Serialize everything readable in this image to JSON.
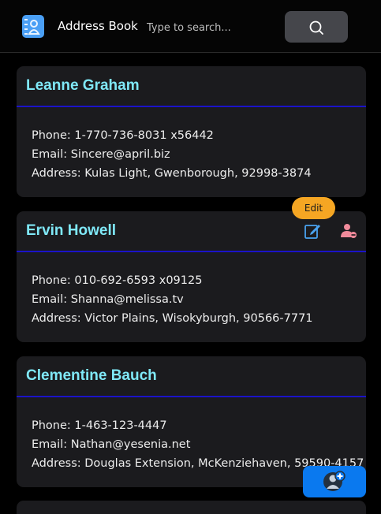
{
  "header": {
    "app_title": "Address Book",
    "search_placeholder": "Type to search...",
    "logo_icon": "contacts-book-icon",
    "search_icon": "search-icon"
  },
  "contacts": [
    {
      "name": "Leanne Graham",
      "phone": "Phone: 1-770-736-8031 x56442",
      "email": "Email: Sincere@april.biz",
      "address": "Address: Kulas Light, Gwenborough, 92998-3874"
    },
    {
      "name": "Ervin Howell",
      "phone": "Phone: 010-692-6593 x09125",
      "email": "Email: Shanna@melissa.tv",
      "address": "Address: Victor Plains, Wisokyburgh, 90566-7771"
    },
    {
      "name": "Clementine Bauch",
      "phone": "Phone: 1-463-123-4447",
      "email": "Email: Nathan@yesenia.net",
      "address": "Address: Douglas Extension, McKenziehaven, 59590-4157"
    }
  ],
  "tooltip": {
    "label": "Edit"
  },
  "actions": {
    "edit_icon": "edit-icon",
    "delete_icon": "remove-user-icon",
    "add_icon": "add-user-icon"
  },
  "colors": {
    "name": "#7fe8f7",
    "divider": "#1b13c9",
    "card_bg": "#1b1b1e",
    "tooltip_bg": "#f5a623",
    "fab_bg": "#0a79ef",
    "edit_icon": "#4aa3f0",
    "delete_icon": "#f08a9a"
  }
}
